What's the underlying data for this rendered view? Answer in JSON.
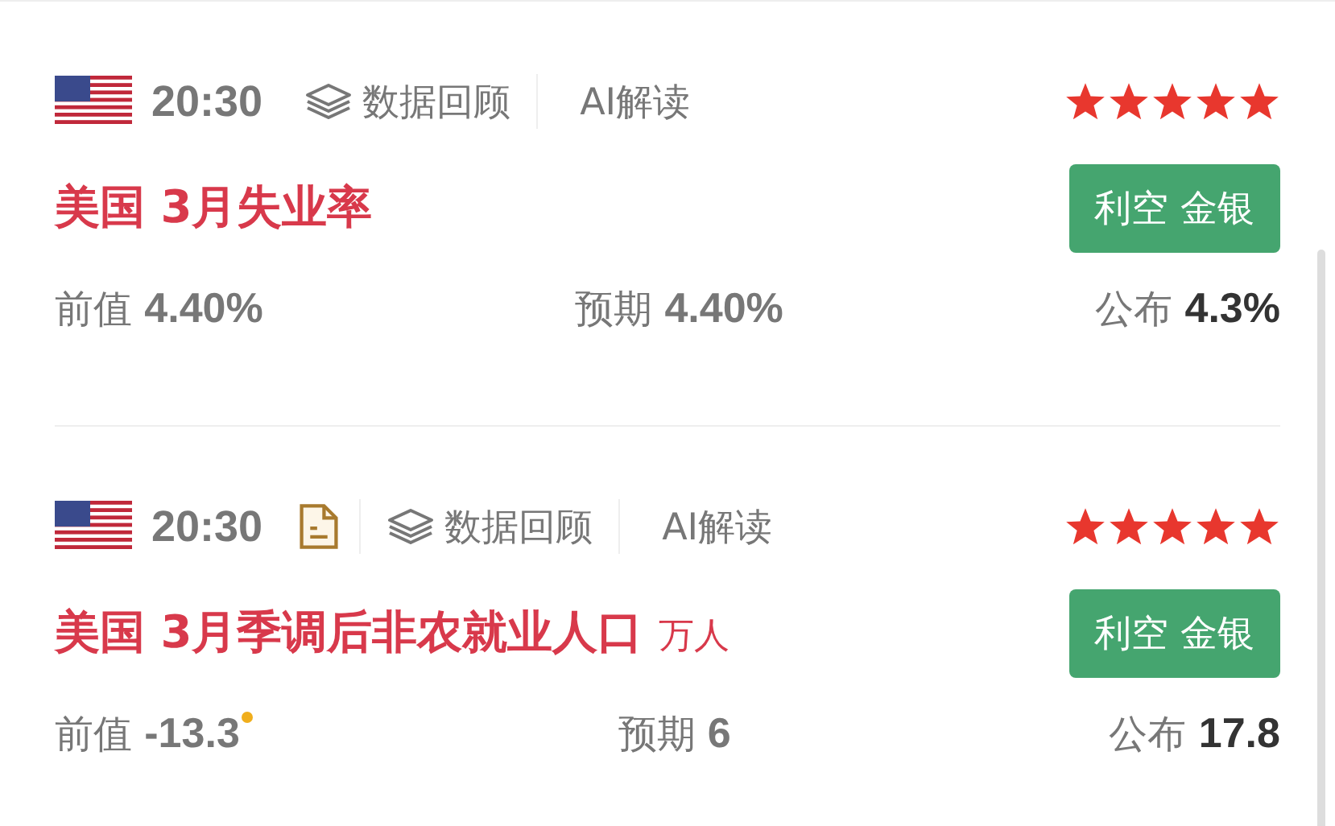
{
  "events": [
    {
      "time": "20:30",
      "has_doc": false,
      "links": [
        "数据回顾",
        "AI解读"
      ],
      "stars": 5,
      "badge": "利空 金银",
      "title": "美国 3月失业率",
      "previous_label": "前值",
      "previous": "4.40%",
      "previous_revised": false,
      "forecast_label": "预期",
      "forecast": "4.40%",
      "actual_label": "公布",
      "actual": "4.3%"
    },
    {
      "time": "20:30",
      "has_doc": true,
      "links": [
        "数据回顾",
        "AI解读"
      ],
      "stars": 5,
      "badge": "利空 金银",
      "title": "美国 3月季调后非农就业人口",
      "unit": "万人",
      "previous_label": "前值",
      "previous": "-13.3",
      "previous_revised": true,
      "forecast_label": "预期",
      "forecast": "6",
      "actual_label": "公布",
      "actual": "17.8"
    }
  ]
}
